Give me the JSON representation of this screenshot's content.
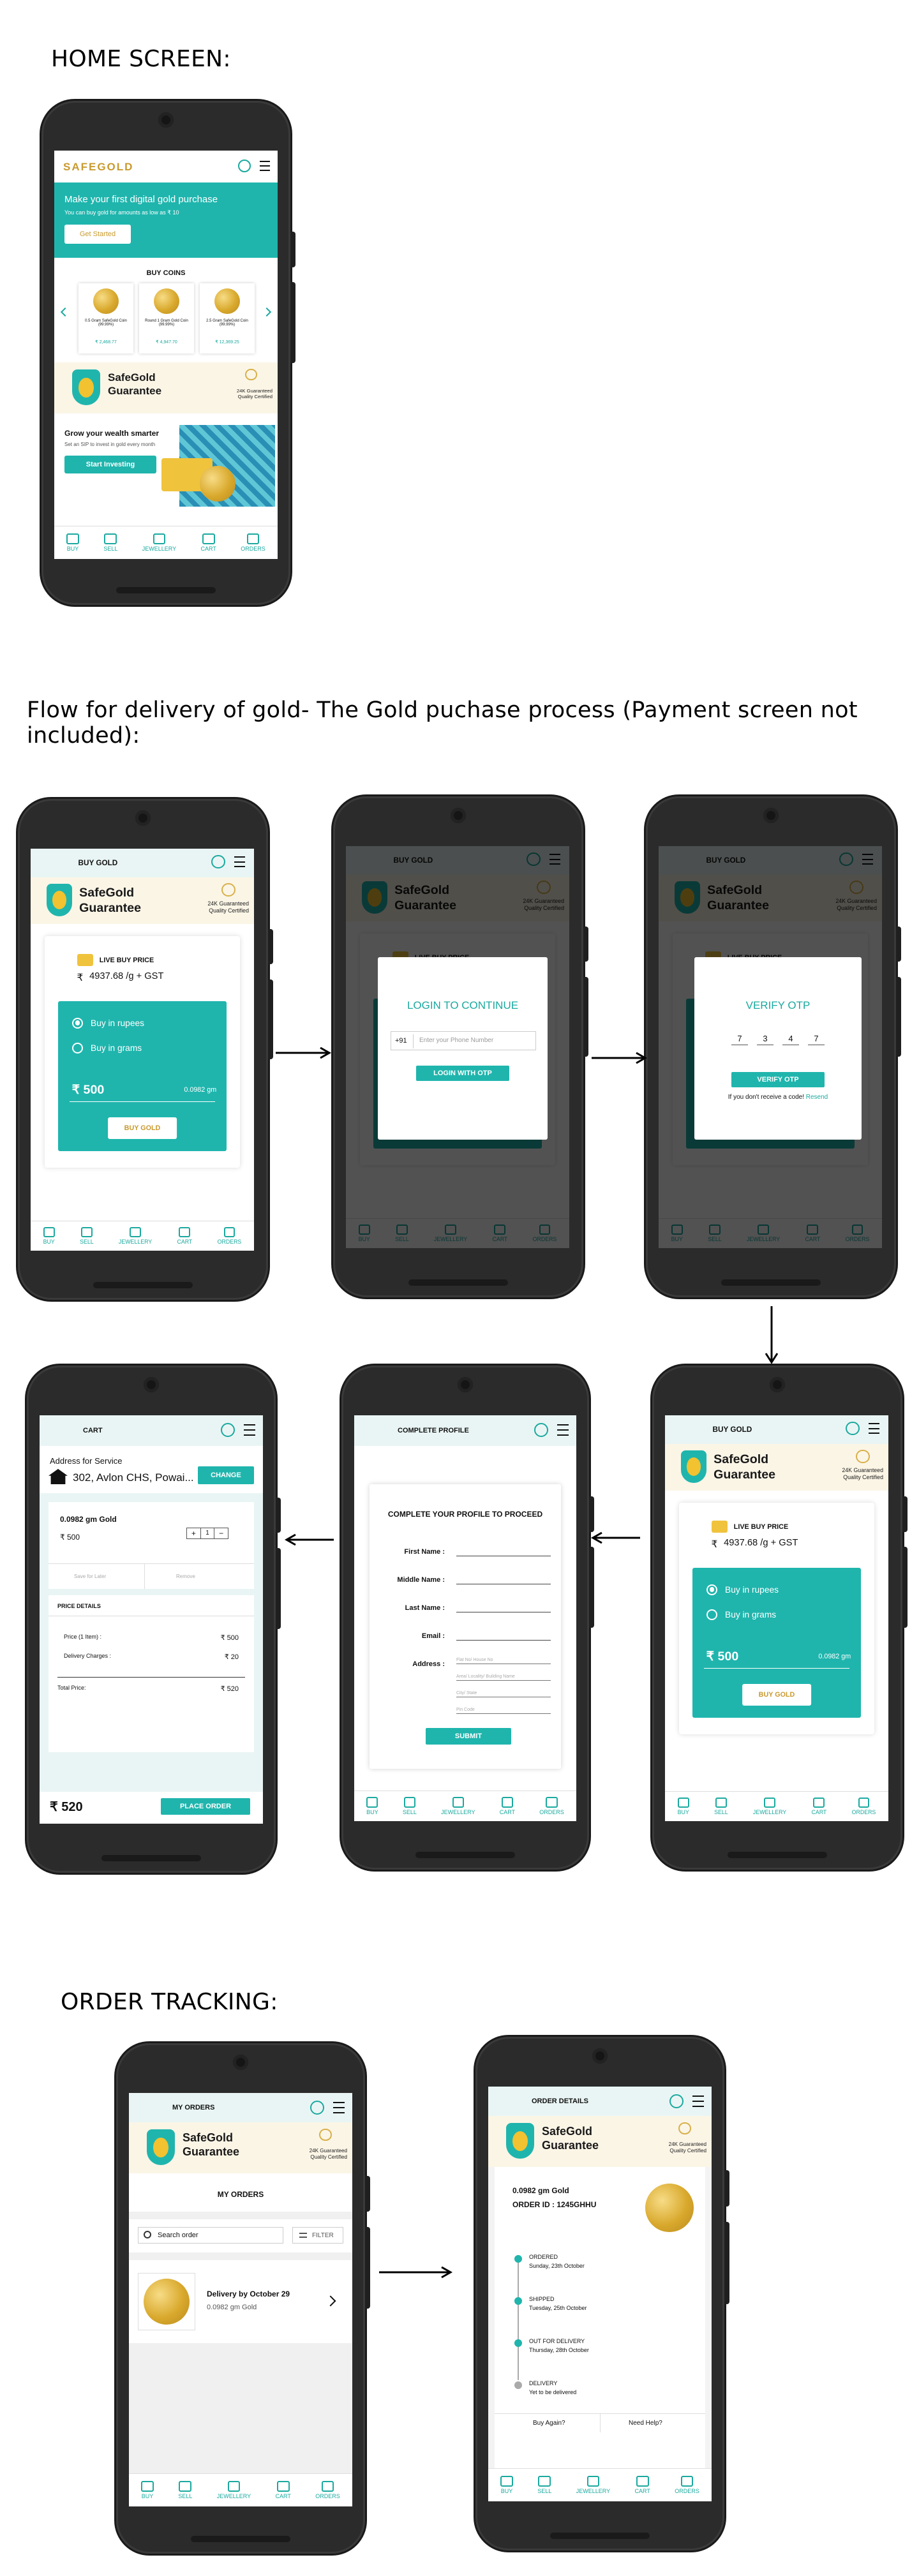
{
  "sections": {
    "home": "HOME SCREEN:",
    "flow": "Flow for delivery of gold- The Gold puchase process (Payment screen not included):",
    "tracking": "ORDER TRACKING:"
  },
  "brand": {
    "logo": "SAFEGOLD",
    "guarantee_line1": "SafeGold",
    "guarantee_line2": "Guarantee",
    "cert1": "24K Guaranteed",
    "cert2": "Quality Certified"
  },
  "nav": [
    "BUY",
    "SELL",
    "JEWELLERY",
    "CART",
    "ORDERS"
  ],
  "home": {
    "hero_title": "Make your first digital gold purchase",
    "hero_sub": "You can buy gold for amounts as low as ₹ 10",
    "get_started": "Get Started",
    "buy_coins": "BUY COINS",
    "coins": [
      {
        "name": "0.5 Gram SafeGold Coin (99.99%)",
        "price": "₹ 2,468.77"
      },
      {
        "name": "Round 1 Gram Gold Coin (99.99%)",
        "price": "₹ 4,947.70"
      },
      {
        "name": "2.5 Gram SafeGold Coin (99.99%)",
        "price": "₹ 12,369.25"
      }
    ],
    "grow_title": "Grow your wealth smarter",
    "grow_sub": "Set an SIP to invest in gold every month",
    "start_investing": "Start Investing"
  },
  "buy": {
    "header": "BUY GOLD",
    "live_price_label": "LIVE BUY PRICE",
    "price": "4937.68 /g + GST",
    "rupee": "₹",
    "opt_rupees": "Buy in rupees",
    "opt_grams": "Buy in grams",
    "amount": "₹ 500",
    "grams": "0.0982 gm",
    "buy_button": "BUY GOLD"
  },
  "login": {
    "title": "LOGIN TO CONTINUE",
    "code": "+91",
    "placeholder": "Enter your Phone Number",
    "button": "LOGIN WITH OTP"
  },
  "otp": {
    "title": "VERIFY OTP",
    "digits": [
      "7",
      "3",
      "4",
      "7"
    ],
    "button": "VERIFY OTP",
    "resend_text": "If you don't receive a code!",
    "resend_link": "Resend"
  },
  "profile": {
    "header": "COMPLETE PROFILE",
    "title": "COMPLETE YOUR PROFILE TO PROCEED",
    "first": "First Name :",
    "middle": "Middle Name :",
    "last": "Last Name :",
    "email": "Email :",
    "address": "Address :",
    "addr_ph": [
      "Flat No/ House No",
      "Area/ Locality/ Building Name",
      "City/ State",
      "Pin Code"
    ],
    "submit": "SUBMIT"
  },
  "cart": {
    "header": "CART",
    "address_label": "Address for Service",
    "address": "302, Avlon CHS, Powai...",
    "change": "CHANGE",
    "item": "0.0982 gm Gold",
    "item_price": "₹ 500",
    "qty": "1",
    "save_later": "Save for Later",
    "remove": "Remove",
    "price_details": "PRICE DETAILS",
    "rows": [
      {
        "label": "Price (1 Item) :",
        "value": "₹ 500"
      },
      {
        "label": "Delivery Charges :",
        "value": "₹ 20"
      },
      {
        "label": "Total Price:",
        "value": "₹ 520"
      }
    ],
    "total": "₹ 520",
    "place_order": "PLACE ORDER"
  },
  "orders": {
    "header": "MY ORDERS",
    "title": "MY ORDERS",
    "search": "Search order",
    "filter": "FILTER",
    "delivery": "Delivery by October 29",
    "item": "0.0982 gm Gold"
  },
  "details": {
    "header": "ORDER DETAILS",
    "item": "0.0982 gm Gold",
    "order_id": "ORDER ID : 1245GHHU",
    "steps": [
      {
        "title": "ORDERED",
        "date": "Sunday, 23th October"
      },
      {
        "title": "SHIPPED",
        "date": "Tuesday, 25th October"
      },
      {
        "title": "OUT FOR DELIVERY",
        "date": "Thursday, 28th October"
      },
      {
        "title": "DELIVERY",
        "date": "Yet to be delivered"
      }
    ],
    "buy_again": "Buy Again?",
    "need_help": "Need Help?"
  }
}
